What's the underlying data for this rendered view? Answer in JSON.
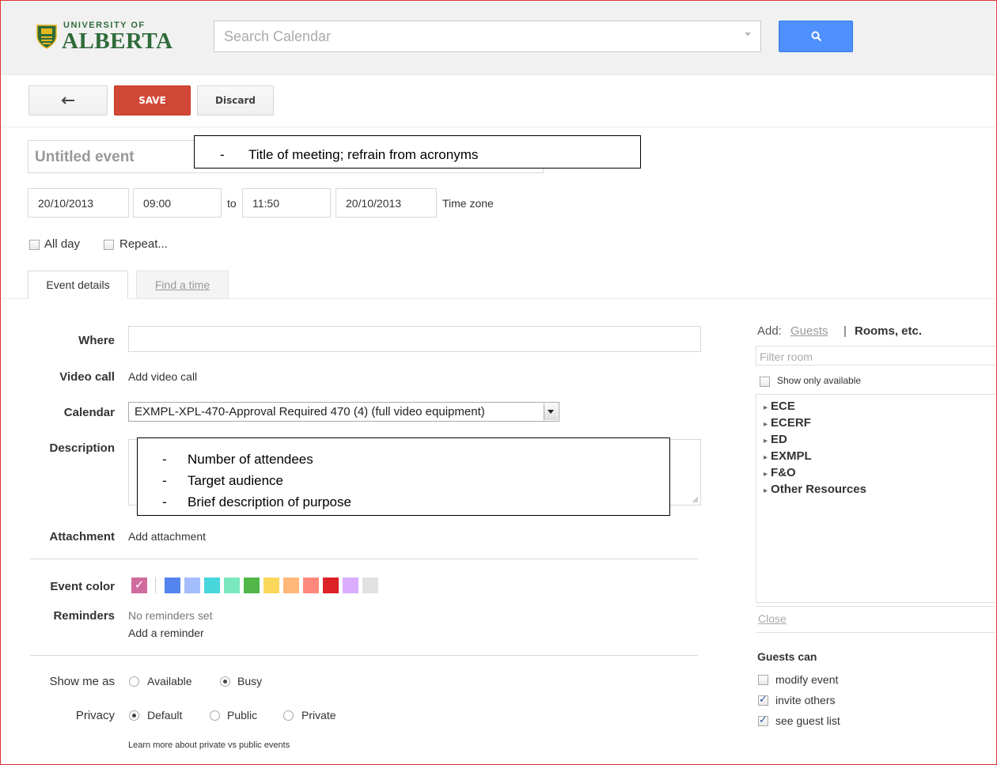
{
  "header": {
    "logo_line1": "UNIVERSITY OF",
    "logo_line2": "ALBERTA",
    "search_placeholder": "Search Calendar"
  },
  "toolbar": {
    "back_icon": "back-arrow-icon",
    "save_label": "SAVE",
    "discard_label": "Discard"
  },
  "event": {
    "title_placeholder": "Untitled event",
    "start_date": "20/10/2013",
    "start_time": "09:00",
    "to_label": "to",
    "end_time": "11:50",
    "end_date": "20/10/2013",
    "timezone_link": "Time zone",
    "all_day_label": "All day",
    "repeat_label": "Repeat..."
  },
  "tabs": [
    {
      "label": "Event details"
    },
    {
      "label": "Find a time"
    }
  ],
  "details": {
    "where_label": "Where",
    "video_label": "Video call",
    "video_link": "Add video call",
    "calendar_label": "Calendar",
    "calendar_value": "EXMPL-XPL-470-Approval Required 470 (4) (full video equipment)",
    "description_label": "Description",
    "attachment_label": "Attachment",
    "attachment_link": "Add attachment",
    "color_label": "Event color",
    "colors": [
      "#d06b9d",
      "#5484ed",
      "#a4bdfc",
      "#46d6db",
      "#7ae7bf",
      "#51b749",
      "#fbd75b",
      "#ffb878",
      "#ff887c",
      "#dc2127",
      "#dbadff",
      "#e1e1e1"
    ],
    "reminders_label": "Reminders",
    "no_reminders": "No reminders set",
    "add_reminder": "Add a reminder",
    "show_as_label": "Show me as",
    "available": "Available",
    "busy": "Busy",
    "privacy_label": "Privacy",
    "default": "Default",
    "public": "Public",
    "private": "Private",
    "learn_more": "Learn more about private vs public events"
  },
  "annotations": {
    "title_note": "Title of meeting; refrain from acronyms",
    "desc_notes": [
      "Number of attendees",
      "Target audience",
      "Brief description of purpose"
    ],
    "bullet": "-"
  },
  "sidebar": {
    "add_label": "Add:",
    "guests_link": "Guests",
    "divider": "|",
    "rooms_label": "Rooms, etc.",
    "filter_placeholder": "Filter room",
    "show_available": "Show only available",
    "rooms": [
      "ECE",
      "ECERF",
      "ED",
      "EXMPL",
      "F&O",
      "Other Resources"
    ],
    "close_link": "Close",
    "guests_can": "Guests can",
    "permissions": [
      {
        "label": "modify event",
        "checked": false
      },
      {
        "label": "invite others",
        "checked": true
      },
      {
        "label": "see guest list",
        "checked": true
      }
    ]
  }
}
